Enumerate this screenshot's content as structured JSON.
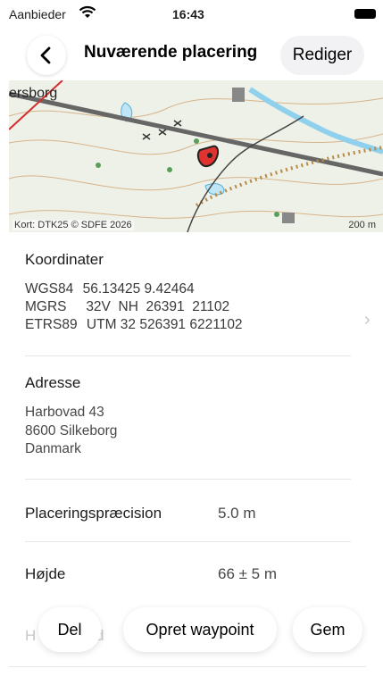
{
  "status": {
    "carrier": "Aanbieder",
    "time": "16:43"
  },
  "header": {
    "title": "Nuværende placering",
    "edit_label": "Rediger"
  },
  "map": {
    "place_label": "ersborg",
    "credit": "Kort: DTK25 © SDFE 2026",
    "scale": "200 m"
  },
  "coordinates": {
    "title": "Koordinater",
    "rows": [
      {
        "system": "WGS84",
        "value": "56.13425  9.42464"
      },
      {
        "system": "MGRS",
        "value": "32V  NH  26391  21102"
      },
      {
        "system": "ETRS89",
        "value": "UTM 32  526391  6221102"
      }
    ]
  },
  "address": {
    "title": "Adresse",
    "lines": [
      "Harbovad 43",
      "8600 Silkeborg",
      "Danmark"
    ]
  },
  "details": [
    {
      "label": "Placeringspræcision",
      "value": "5.0 m"
    },
    {
      "label": "Højde",
      "value": "66 ± 5 m"
    }
  ],
  "faded_row": {
    "label_fragment": "H",
    "label_fragment2": "d"
  },
  "actions": {
    "share": "Del",
    "create_waypoint": "Opret waypoint",
    "save": "Gem"
  },
  "colors": {
    "pin": "#e0322f",
    "water": "#bfe6f7",
    "road": "#555555",
    "contour": "#d7b48a"
  },
  "icons": {
    "back": "chevron-left-icon",
    "wifi": "wifi-icon",
    "battery": "battery-icon",
    "disclosure": "chevron-right-icon",
    "pin": "location-pin-icon"
  }
}
